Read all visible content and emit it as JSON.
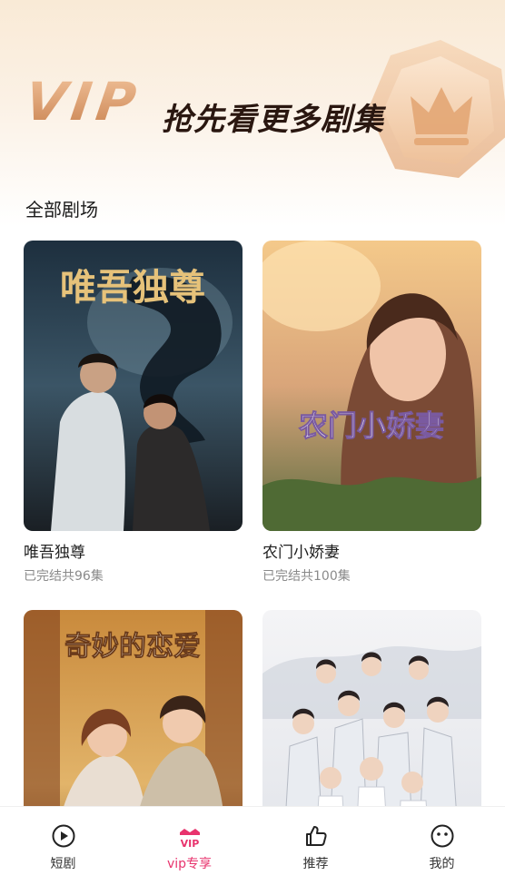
{
  "banner": {
    "vip": "VIP",
    "slogan": "抢先看更多剧集"
  },
  "section": {
    "title": "全部剧场"
  },
  "dramas": [
    {
      "title": "唯吾独尊",
      "meta": "已完结共96集",
      "cover_text": "唯吾独尊"
    },
    {
      "title": "农门小娇妻",
      "meta": "已完结共100集",
      "cover_text": "农门小娇妻"
    },
    {
      "title": "",
      "meta": "",
      "cover_text": "奇妙的恋爱"
    },
    {
      "title": "",
      "meta": "",
      "cover_text": ""
    }
  ],
  "tabs": [
    {
      "label": "短剧",
      "icon": "play-circle-icon"
    },
    {
      "label": "vip专享",
      "icon": "vip-crown-icon",
      "active": true,
      "badge": "VIP"
    },
    {
      "label": "推荐",
      "icon": "thumbs-up-icon"
    },
    {
      "label": "我的",
      "icon": "smiley-face-icon"
    }
  ],
  "colors": {
    "accent": "#e8336d",
    "vip_gold": "#d49b6c"
  }
}
